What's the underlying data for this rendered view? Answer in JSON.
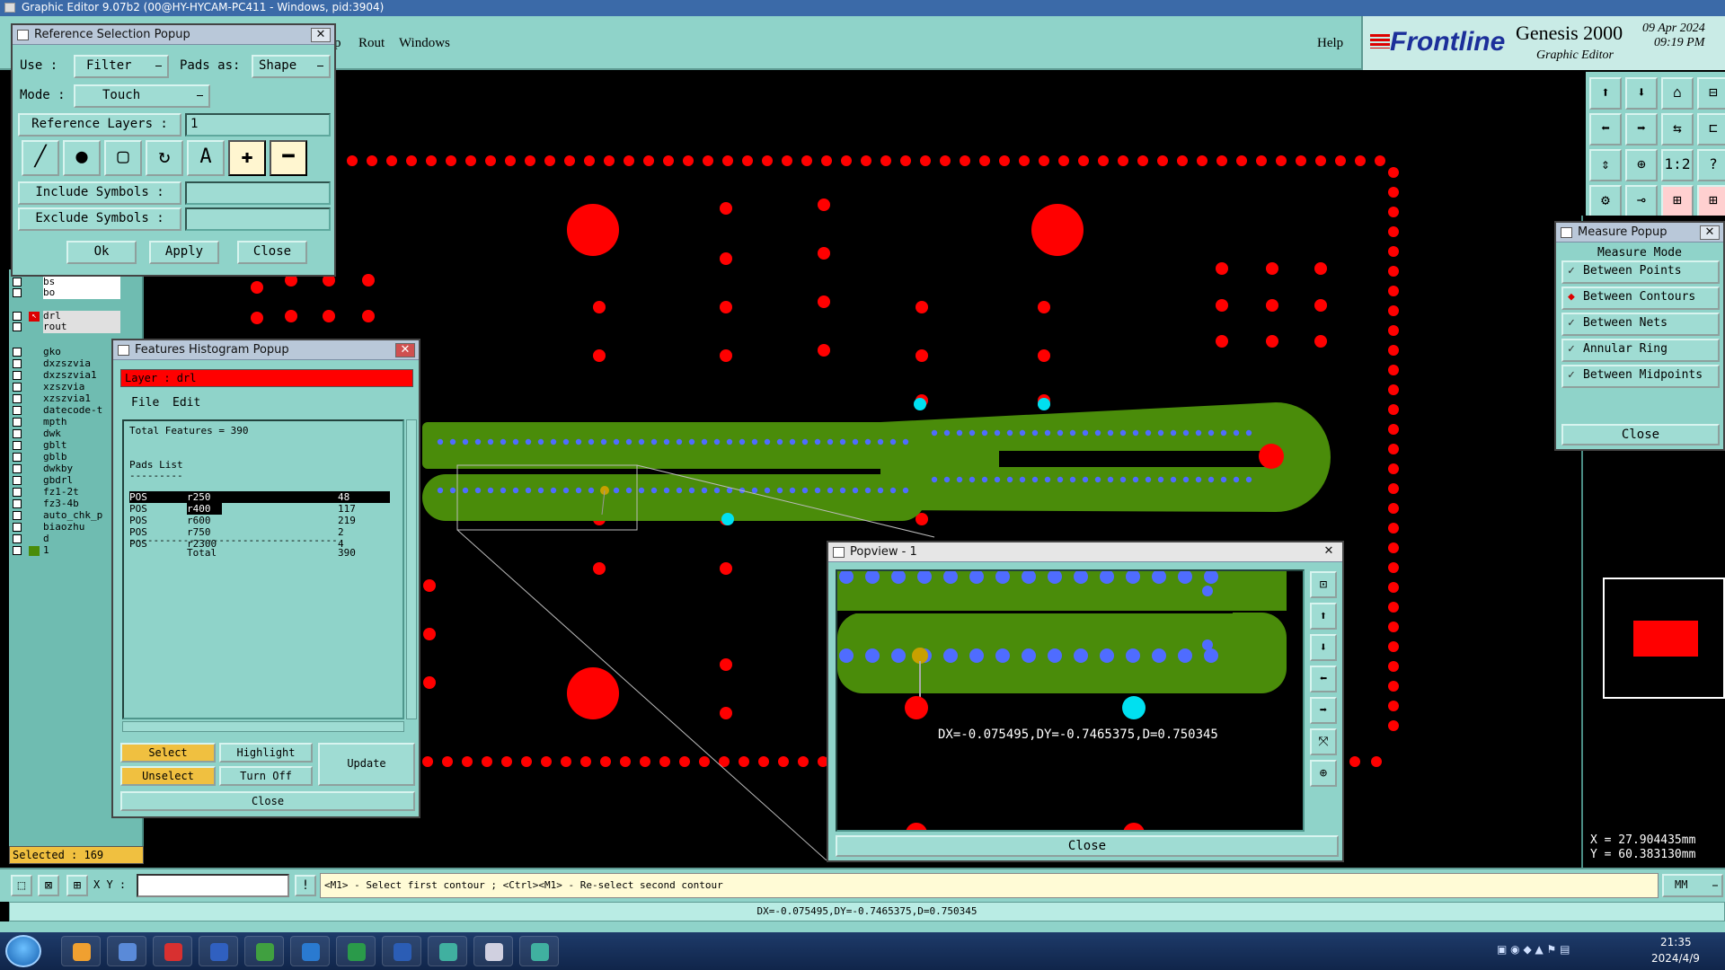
{
  "titlebar": {
    "text": "Graphic Editor 9.07b2 (00@HY-HYCAM-PC411 - Windows, pid:3904)"
  },
  "menu": {
    "items": [
      "p",
      "Rout",
      "Windows"
    ],
    "help": "Help"
  },
  "brand": {
    "logo": "Frontline",
    "product": "Genesis 2000",
    "subtitle": "Graphic Editor",
    "date": "09 Apr 2024",
    "time": "09:19 PM"
  },
  "ref_popup": {
    "title": "Reference Selection Popup",
    "use_label": "Use  :",
    "use_value": "Filter",
    "pads_label": "Pads as:",
    "pads_value": "Shape",
    "mode_label": "Mode  :",
    "mode_value": "Touch",
    "ref_layers_label": "Reference Layers :",
    "ref_layers_value": "1",
    "include_label": "Include Symbols :",
    "include_value": "",
    "exclude_label": "Exclude Symbols :",
    "exclude_value": "",
    "ok": "Ok",
    "apply": "Apply",
    "close": "Close"
  },
  "layers": {
    "items": [
      "bs",
      "bo",
      "drl",
      "rout",
      "gko",
      "dxzszvia",
      "dxzszvia1",
      "xzszvia",
      "xzszvia1",
      "datecode-t",
      "mpth",
      "dwk",
      "gblt",
      "gblb",
      "dwkby",
      "gbdrl",
      "fz1-2t",
      "fz3-4b",
      "auto_chk_p",
      "biaozhu",
      "d",
      "1"
    ],
    "selected_status": "Selected : 169"
  },
  "histogram": {
    "title": "Features Histogram Popup",
    "layer_label": "Layer :  drl",
    "menu_file": "File",
    "menu_edit": "Edit",
    "total_features": "Total Features = 390",
    "pads_list": "Pads List",
    "underline": "---------",
    "rows": [
      {
        "pol": "POS",
        "sym": "r250",
        "count": "48"
      },
      {
        "pol": "POS",
        "sym": "r400",
        "count": "117"
      },
      {
        "pol": "POS",
        "sym": "r600",
        "count": "219"
      },
      {
        "pol": "POS",
        "sym": "r750",
        "count": "2"
      },
      {
        "pol": "POS",
        "sym": "r2300",
        "count": "4"
      }
    ],
    "separator": "-----------------------------------",
    "total_label": "Total",
    "total_value": "390",
    "select": "Select",
    "highlight": "Highlight",
    "unselect": "Unselect",
    "turn_off": "Turn Off",
    "update": "Update",
    "close": "Close"
  },
  "measure": {
    "title": "Measure Popup",
    "mode_header": "Measure Mode",
    "options": [
      "Between Points",
      "Between Contours",
      "Between Nets",
      "Annular Ring",
      "Between Midpoints"
    ],
    "selected_index": 1,
    "close": "Close"
  },
  "popview": {
    "title": "Popview - 1",
    "measure_text": "DX=-0.075495,DY=-0.7465375,D=0.750345",
    "close": "Close"
  },
  "coords": {
    "x": "X = 27.904435mm",
    "y": "Y = 60.383130mm"
  },
  "bottom": {
    "xy_label": "X Y :",
    "xy_value": "",
    "prompt": "<M1> - Select first contour ; <Ctrl><M1> - Re-select second contour",
    "units": "MM",
    "status": "DX=-0.075495,DY=-0.7465375,D=0.750345"
  },
  "taskbar": {
    "time": "21:35",
    "date": "2024/4/9"
  },
  "colors": {
    "teal": "#8fd3c9",
    "pad_red": "#ff0000",
    "trace_green": "#4a8c0a",
    "via_blue": "#4f6cff",
    "cyan": "#00e0f0",
    "gold": "#c8a000"
  }
}
